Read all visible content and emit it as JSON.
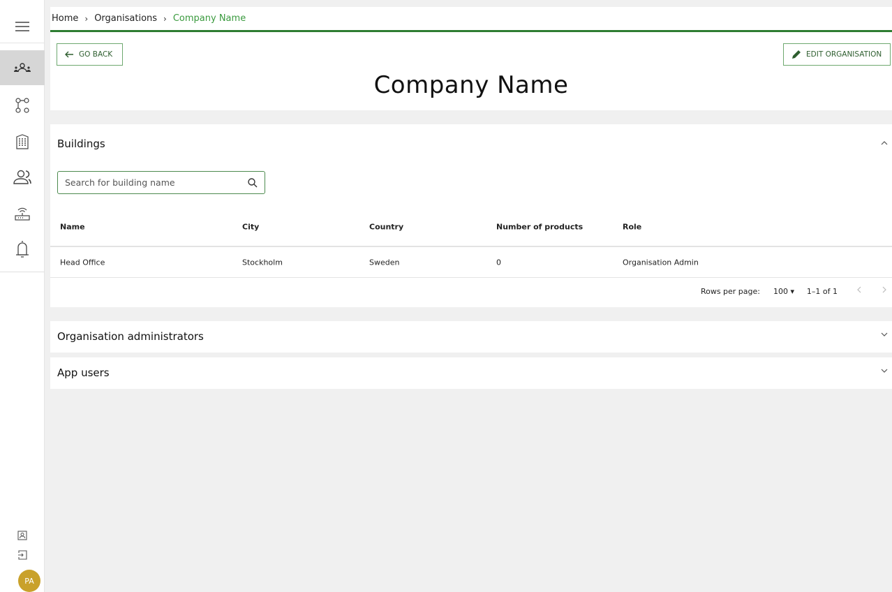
{
  "breadcrumb": {
    "items": [
      "Home",
      "Organisations",
      "Company Name"
    ],
    "separator": "›"
  },
  "header": {
    "back_label": "GO BACK",
    "edit_label": "EDIT ORGANISATION",
    "title": "Company Name"
  },
  "buildings": {
    "title": "Buildings",
    "search_placeholder": "Search for building name",
    "columns": [
      "Name",
      "City",
      "Country",
      "Number of products",
      "Role"
    ],
    "rows": [
      [
        "Head Office",
        "Stockholm",
        "Sweden",
        "0",
        "Organisation Admin"
      ]
    ],
    "pagination": {
      "rows_per_page_label": "Rows per page:",
      "rows_per_page_value": "100",
      "range": "1–1 of 1"
    }
  },
  "sections": {
    "admins_title": "Organisation administrators",
    "users_title": "App users"
  },
  "user": {
    "initials": "PA"
  },
  "colors": {
    "accent": "#2e7d32",
    "breadcrumb_current": "#3a9a3e",
    "avatar": "#c9a12a",
    "active_nav": "#d6d6d6",
    "background": "#f0f0f0"
  },
  "icons": [
    "menu-icon",
    "organisations-icon",
    "hierarchy-icon",
    "building-icon",
    "users-icon",
    "router-icon",
    "bell-icon",
    "profile-card-icon",
    "logout-icon",
    "arrow-left-icon",
    "pencil-icon",
    "search-icon",
    "chevron-up-icon",
    "chevron-down-icon"
  ]
}
